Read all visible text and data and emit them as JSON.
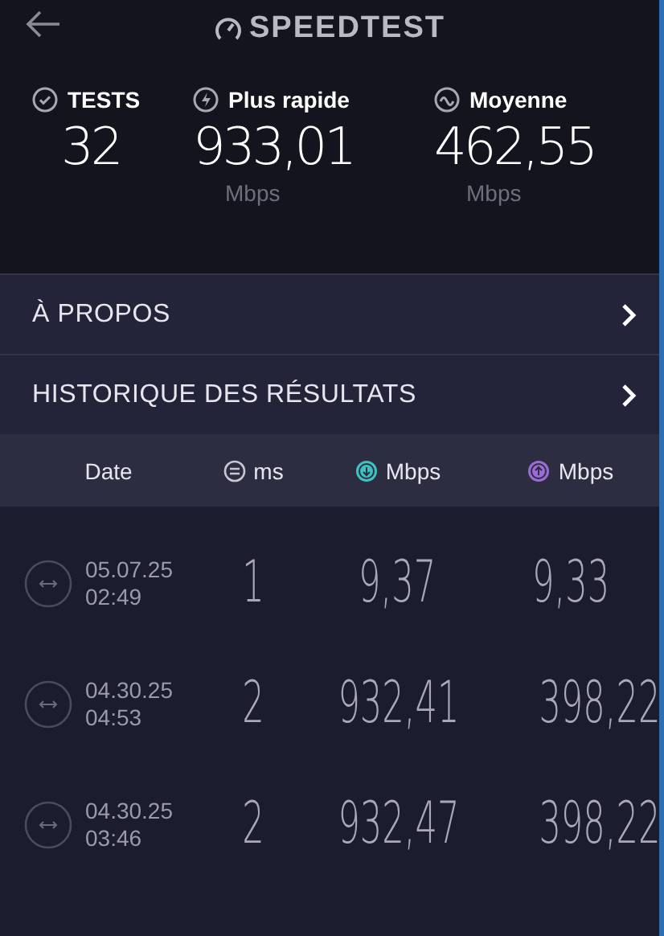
{
  "header": {
    "logo": "SPEEDTEST"
  },
  "stats": [
    {
      "kind": "tests",
      "label": "TESTS",
      "value": "32"
    },
    {
      "kind": "fastest",
      "label": "Plus rapide",
      "value": "933,01",
      "unit": "Mbps"
    },
    {
      "kind": "average",
      "label": "Moyenne",
      "value": "462,55",
      "unit": "Mbps"
    }
  ],
  "nav_items": [
    {
      "label": "À PROPOS"
    },
    {
      "label": "HISTORIQUE DES RÉSULTATS"
    }
  ],
  "table": {
    "columns": [
      {
        "kind": "date",
        "label": "Date"
      },
      {
        "kind": "ping",
        "label": "ms",
        "color": "#c8c8d2"
      },
      {
        "kind": "download",
        "label": "Mbps",
        "color": "#3fc1c0"
      },
      {
        "kind": "upload",
        "label": "Mbps",
        "color": "#9b6bd6"
      }
    ],
    "rows": [
      {
        "date": "05.07.25",
        "time": "02:49",
        "ping": "1",
        "download": "9,37",
        "upload": "9,33"
      },
      {
        "date": "04.30.25",
        "time": "04:53",
        "ping": "2",
        "download": "932,41",
        "upload": "398,22"
      },
      {
        "date": "04.30.25",
        "time": "03:46",
        "ping": "2",
        "download": "932,47",
        "upload": "398,22"
      }
    ]
  }
}
